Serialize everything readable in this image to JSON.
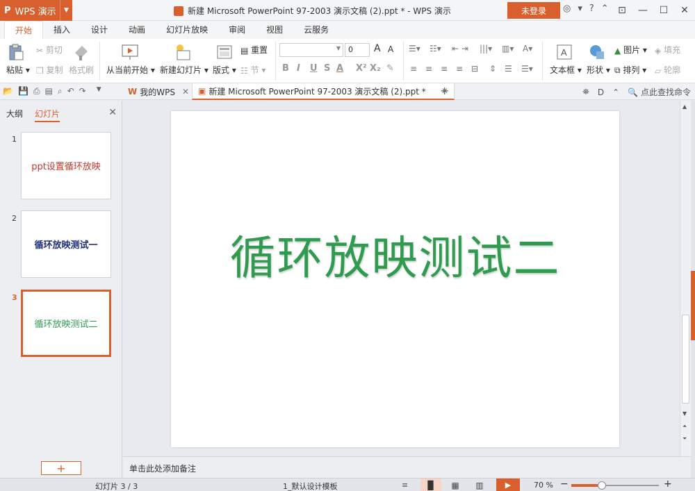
{
  "titlebar": {
    "app_logo": "P",
    "app_name": "WPS 演示",
    "title": "新建 Microsoft PowerPoint 97-2003 演示文稿 (2).ppt * - WPS 演示",
    "login": "未登录"
  },
  "ribbon_tabs": [
    "开始",
    "插入",
    "设计",
    "动画",
    "幻灯片放映",
    "审阅",
    "视图",
    "云服务"
  ],
  "toolbar": {
    "paste": "粘贴",
    "cut": "剪切",
    "copy": "复制",
    "format_painter": "格式刷",
    "from_current": "从当前开始",
    "new_slide": "新建幻灯片",
    "layout": "版式",
    "reset": "重置",
    "section": "节",
    "font_size": "0",
    "textbox": "文本框",
    "shape": "形状",
    "picture": "图片",
    "arrange": "排列",
    "fill": "填充",
    "outline": "轮廓"
  },
  "doc_tabs": {
    "home": "我的WPS",
    "active": "新建 Microsoft PowerPoint 97-2003 演示文稿 (2).ppt *",
    "search": "点此查找命令"
  },
  "left_pane": {
    "tab_outline": "大纲",
    "tab_slides": "幻灯片",
    "slides": [
      {
        "num": "1",
        "text": "ppt设置循环放映",
        "color": "#c0392b"
      },
      {
        "num": "2",
        "text": "循环放映测试一",
        "color": "#1f2d7a"
      },
      {
        "num": "3",
        "text": "循环放映测试二",
        "color": "#2e9b4e"
      }
    ],
    "add_symbol": "+"
  },
  "slide": {
    "text": "循环放映测试二",
    "color": "#2e9b4e"
  },
  "notes_placeholder": "单击此处添加备注",
  "status": {
    "slide_counter": "幻灯片 3 / 3",
    "template": "1_默认设计模板",
    "zoom": "70 %",
    "accent": "#d9602e"
  }
}
